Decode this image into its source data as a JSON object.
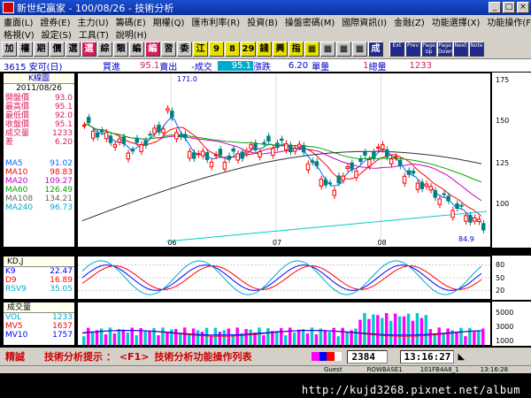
{
  "window": {
    "title": "新世紀贏家 - 100/08/26 - 技術分析"
  },
  "menu": {
    "row1": [
      "畫面(L)",
      "證券(E)",
      "主力(U)",
      "籌碼(E)",
      "期權(Q)",
      "匯市利率(R)",
      "投資(B)",
      "操盤密碼(M)",
      "國際資訊(I)",
      "金融(Z)",
      "功能選擇(X)",
      "功能操作(F)"
    ],
    "row2": [
      "格視(V)",
      "設定(S)",
      "工具(T)",
      "說明(H)"
    ]
  },
  "toolbar": {
    "buttons": [
      {
        "label": "加",
        "bg": "#c8c8c8",
        "fg": "#000"
      },
      {
        "label": "權",
        "bg": "#c8c8c8",
        "fg": "#000"
      },
      {
        "label": "期",
        "bg": "#c8c8c8",
        "fg": "#000"
      },
      {
        "label": "價",
        "bg": "#c8c8c8",
        "fg": "#000"
      },
      {
        "label": "選",
        "bg": "#c8c8c8",
        "fg": "#000"
      },
      {
        "label": "選",
        "bg": "#d81b60",
        "fg": "#fff"
      },
      {
        "label": "綜",
        "bg": "#c8c8c8",
        "fg": "#000"
      },
      {
        "label": "類",
        "bg": "#c8c8c8",
        "fg": "#000"
      },
      {
        "label": "編",
        "bg": "#c8c8c8",
        "fg": "#000"
      },
      {
        "label": "編",
        "bg": "#d81b60",
        "fg": "#fff"
      },
      {
        "label": "習",
        "bg": "#c8c8c8",
        "fg": "#000"
      },
      {
        "label": "委",
        "bg": "#c8c8c8",
        "fg": "#000"
      },
      {
        "label": "江",
        "bg": "#e8e000",
        "fg": "#000"
      },
      {
        "label": "9",
        "bg": "#e8e000",
        "fg": "#000"
      },
      {
        "label": "8",
        "bg": "#e8e000",
        "fg": "#000"
      },
      {
        "label": "29",
        "bg": "#e8e000",
        "fg": "#000"
      },
      {
        "label": "錢",
        "bg": "#e8e000",
        "fg": "#000"
      },
      {
        "label": "興",
        "bg": "#e8e000",
        "fg": "#000"
      },
      {
        "label": "指",
        "bg": "#e8e000",
        "fg": "#000"
      },
      {
        "label": "▦",
        "bg": "#e8e000",
        "fg": "#000"
      },
      {
        "label": "▦",
        "bg": "#c8c8c8",
        "fg": "#000"
      },
      {
        "label": "▦",
        "bg": "#c8c8c8",
        "fg": "#000"
      },
      {
        "label": "▦",
        "bg": "#c8c8c8",
        "fg": "#000"
      },
      {
        "label": "成",
        "bg": "#1f2a8a",
        "fg": "#fff"
      }
    ],
    "small_buttons": [
      "Ext",
      "Prev",
      "Page Up",
      "Page Down",
      "Next",
      "Note"
    ]
  },
  "quote": {
    "symbol": "3615 安可(日)",
    "bid_label": "買進",
    "bid": "95.1",
    "ask_label": "賣出",
    "change_label": "-成交",
    "price": "95.1",
    "change_dir_label": "漲跌",
    "change": "6.20",
    "unit_label": "單量",
    "unit": "1",
    "total_label": "總量",
    "total": "1233"
  },
  "kline_panel": {
    "header": "K線圖",
    "date": "2011/08/26",
    "rows": [
      {
        "label": "開盤價",
        "value": "93.0",
        "color": "#d81b60"
      },
      {
        "label": "最高價",
        "value": "95.1",
        "color": "#d81b60"
      },
      {
        "label": "最低價",
        "value": "92.0",
        "color": "#d81b60"
      },
      {
        "label": "收盤價",
        "value": "95.1",
        "color": "#d81b60"
      },
      {
        "label": "成交量",
        "value": "1233",
        "color": "#d81b60"
      },
      {
        "label": "差",
        "value": "6.20",
        "color": "#d81b60"
      }
    ],
    "ma_rows": [
      {
        "label": "MA5",
        "value": "91.02",
        "color": "#0066ff"
      },
      {
        "label": "MA10",
        "value": "98.83",
        "color": "#ff0000"
      },
      {
        "label": "MA20",
        "value": "109.27",
        "color": "#cc00cc"
      },
      {
        "label": "MA60",
        "value": "126.49",
        "color": "#00aa00"
      },
      {
        "label": "MA108",
        "value": "134.21",
        "color": "#666666"
      },
      {
        "label": "MA240",
        "value": "96.73",
        "color": "#00aacc"
      }
    ]
  },
  "kd_panel": {
    "header": "KD,J",
    "rows": [
      {
        "label": "K9",
        "value": "22.47",
        "color": "#0000ff"
      },
      {
        "label": "D9",
        "value": "16.89",
        "color": "#ff0000"
      },
      {
        "label": "RSV9",
        "value": "35.05",
        "color": "#00aacc"
      }
    ]
  },
  "vol_panel": {
    "header": "成交量",
    "rows": [
      {
        "label": "VOL",
        "value": "1233",
        "color": "#00aacc"
      },
      {
        "label": "MV5",
        "value": "1637",
        "color": "#ff0000"
      },
      {
        "label": "MV10",
        "value": "1757",
        "color": "#0000ff"
      }
    ]
  },
  "axes": {
    "price_ticks": [
      "175",
      "150",
      "125",
      "100"
    ],
    "kd_ticks": [
      "80",
      "50",
      "20"
    ],
    "vol_ticks": [
      "5000",
      "3000",
      "1000"
    ],
    "month_labels": [
      "06",
      "07",
      "08"
    ],
    "high_label": "171.0",
    "low_label": "84.9"
  },
  "status": {
    "left": "精誠",
    "hint": "技術分析提示 ：",
    "hint_key": "<F1>",
    "hint_text": "技術分析功能操作列表",
    "code": "2384",
    "time": "13:16:27"
  },
  "hintbar": {
    "items": [
      "Guest",
      "ROWBASE1",
      "101FB4A8_1",
      "13:16:28"
    ]
  },
  "watermark": {
    "url": "http://kujd3268.pixnet.net/album"
  },
  "colors": {
    "up": "#ff0000",
    "down": "#008080",
    "ma5": "#0066ff",
    "ma10": "#ff0000",
    "ma20": "#cc00cc",
    "ma60": "#00aa00",
    "ma108": "#333333",
    "ma240": "#00cccc"
  }
}
